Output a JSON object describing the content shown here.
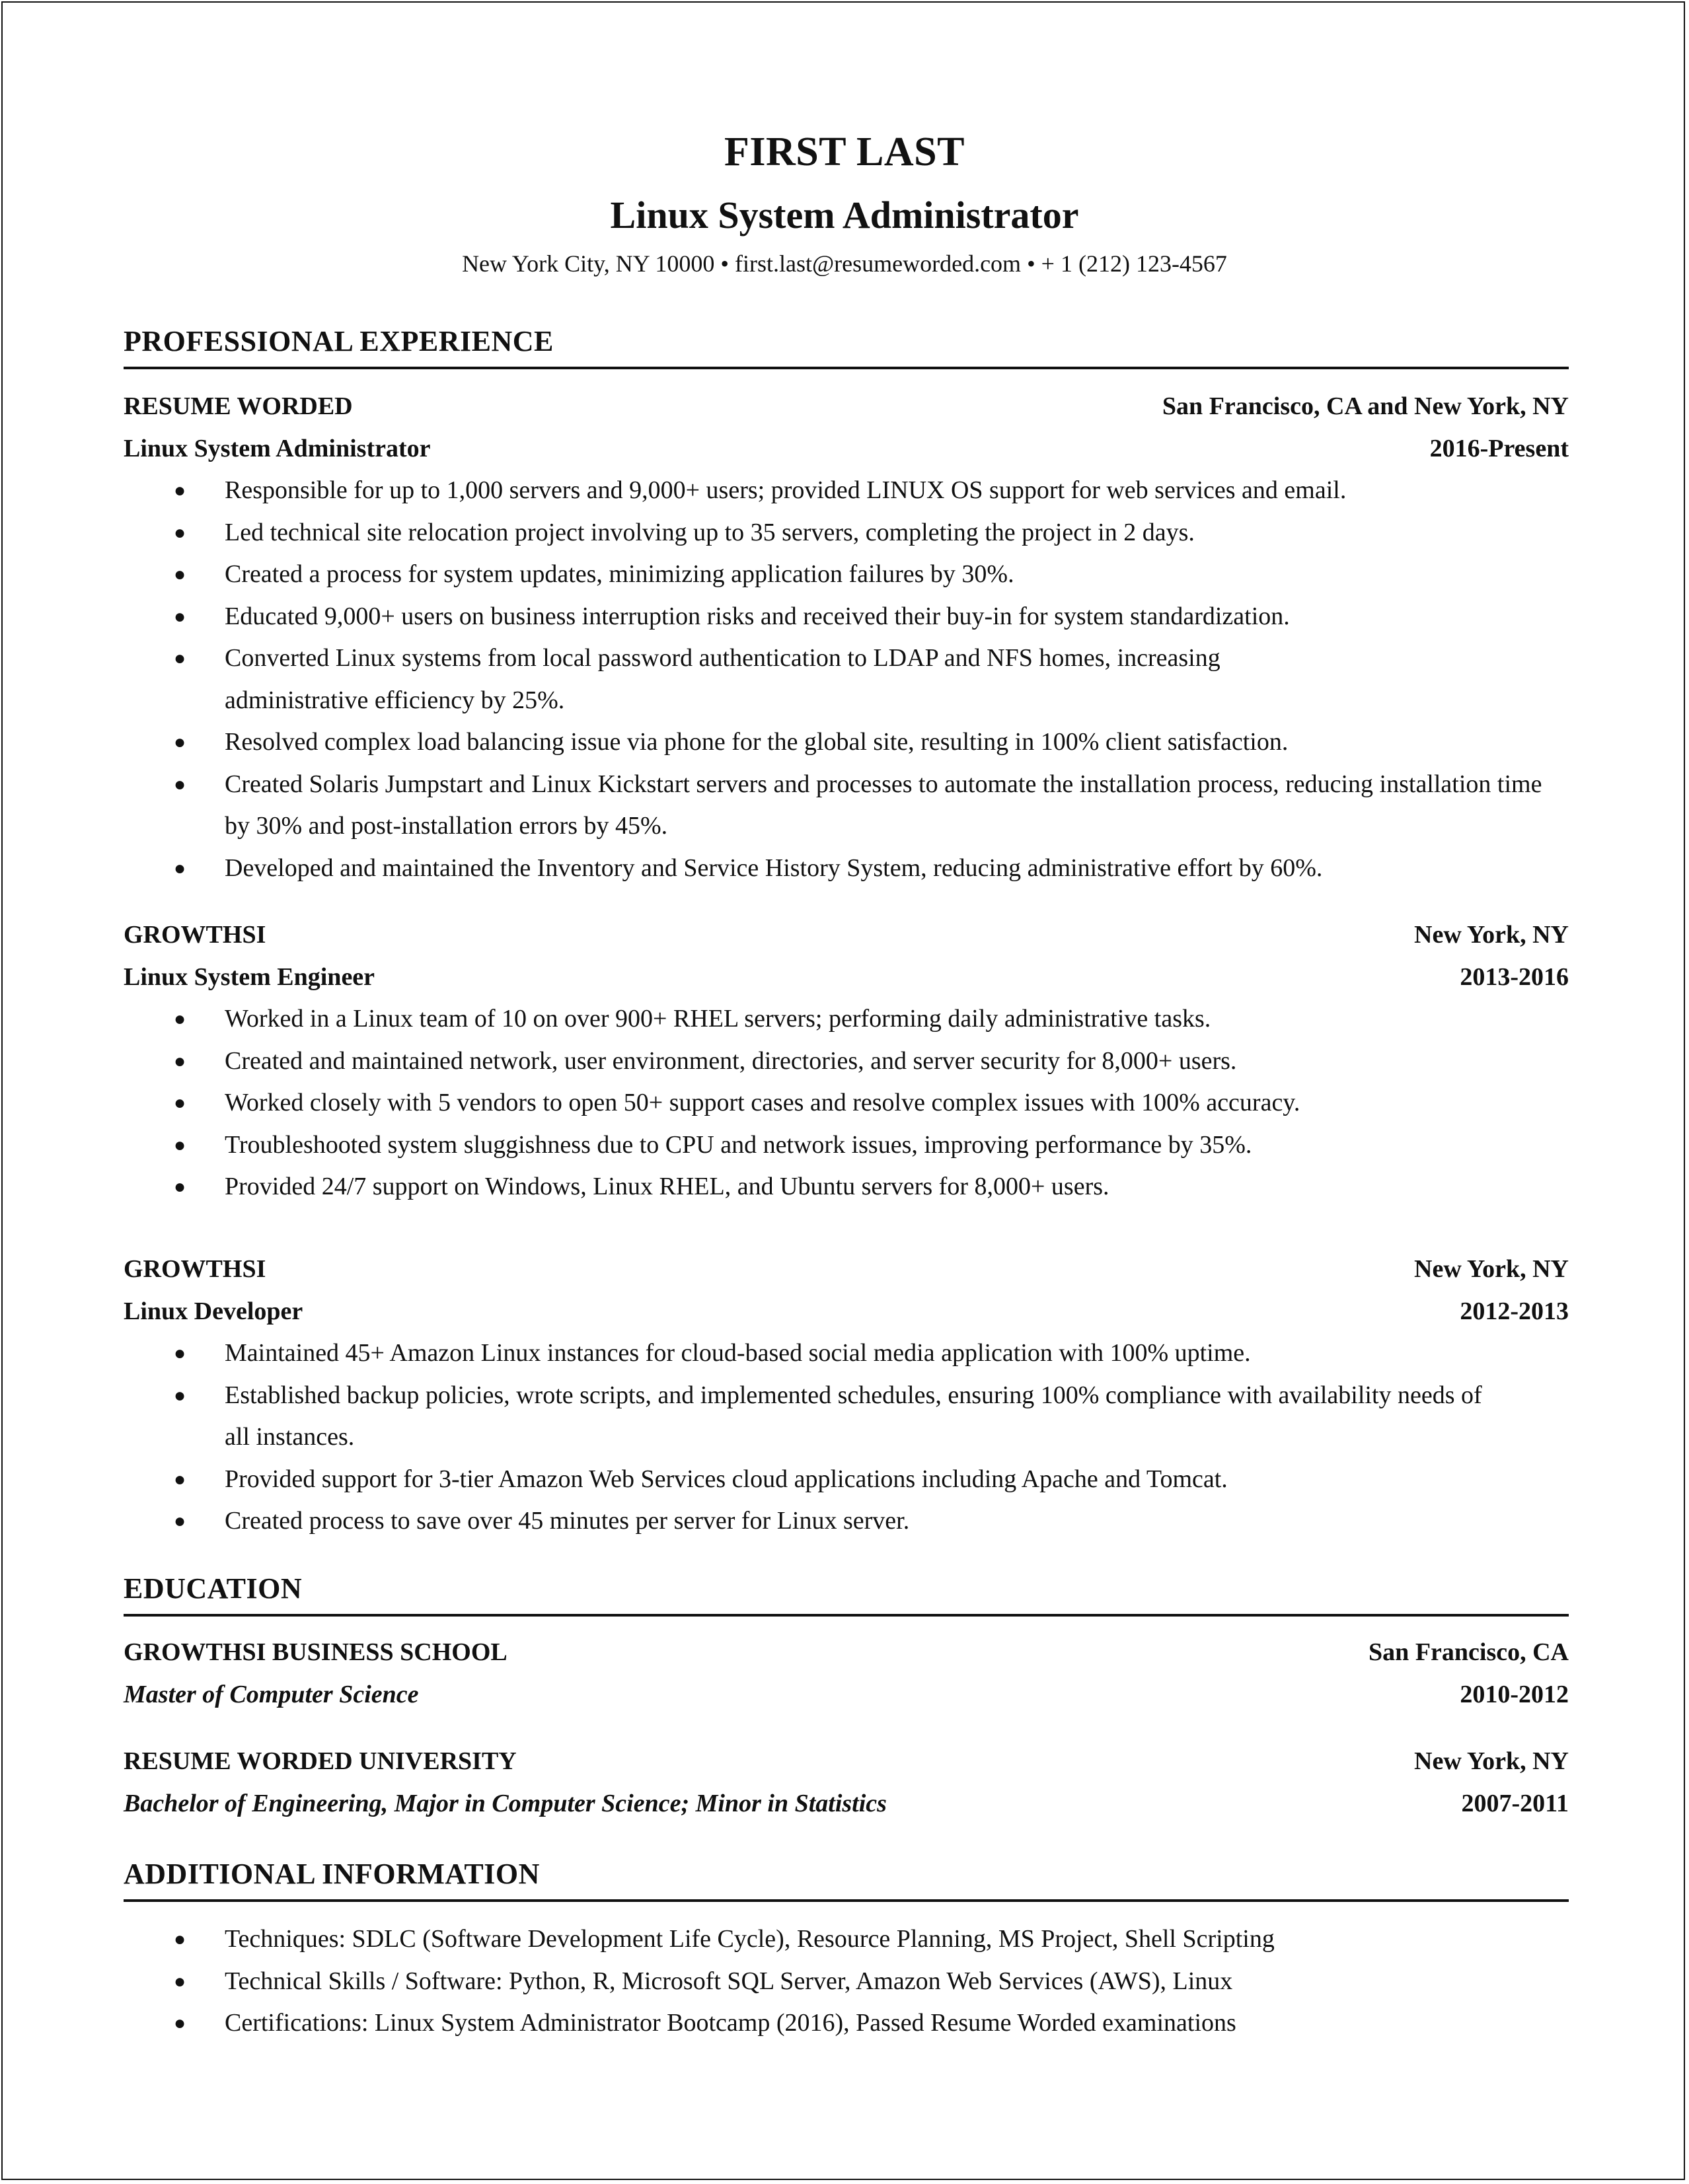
{
  "header": {
    "name": "FIRST LAST",
    "title": "Linux System Administrator",
    "contact": "New York City, NY 10000 • first.last@resumeworded.com • + 1 (212) 123-4567"
  },
  "sections": {
    "experience": {
      "heading": "PROFESSIONAL EXPERIENCE",
      "jobs": [
        {
          "company": "RESUME WORDED",
          "location": "San Francisco, CA and New York, NY",
          "role": "Linux System Administrator",
          "dates": "2016-Present",
          "bullets": [
            "Responsible for up to 1,000 servers and 9,000+ users; provided LINUX OS support for web services and email.",
            "Led technical site relocation project involving up to 35 servers, completing the project in 2 days.",
            "Created a process for system updates, minimizing application failures by 30%.",
            "Educated 9,000+ users on business interruption risks and received their buy-in for system standardization.",
            "Converted Linux systems from local password authentication to LDAP and NFS homes, increasing administrative efficiency by 25%.",
            "Resolved complex load balancing issue via phone for the global site, resulting in 100% client satisfaction.",
            "Created Solaris Jumpstart and Linux Kickstart servers and processes to automate the installation process, reducing installation time by 30% and post-installation errors by 45%.",
            "Developed and maintained the Inventory and Service History System, reducing administrative effort by 60%."
          ]
        },
        {
          "company": "GROWTHSI",
          "location": "New York, NY",
          "role": "Linux System Engineer",
          "dates": "2013-2016",
          "bullets": [
            "Worked in a Linux team of 10 on over 900+ RHEL servers; performing daily administrative tasks.",
            "Created and maintained network, user environment, directories, and server security for 8,000+ users.",
            "Worked closely with 5 vendors to open 50+ support cases and resolve complex issues with 100% accuracy.",
            "Troubleshooted system sluggishness due to CPU and network issues, improving performance by 35%.",
            "Provided 24/7 support on Windows, Linux RHEL, and Ubuntu servers for 8,000+ users."
          ]
        },
        {
          "company": "GROWTHSI",
          "location": "New York, NY",
          "role": "Linux Developer",
          "dates": "2012-2013",
          "bullets": [
            "Maintained 45+ Amazon Linux instances for cloud-based social media application with 100% uptime.",
            "Established backup policies, wrote scripts, and implemented schedules, ensuring 100% compliance with availability needs of all instances.",
            "Provided support for 3-tier Amazon Web Services cloud applications including Apache and Tomcat.",
            "Created process to save over 45 minutes per server for Linux server."
          ]
        }
      ]
    },
    "education": {
      "heading": "EDUCATION",
      "schools": [
        {
          "school": "GROWTHSI BUSINESS SCHOOL",
          "location": "San Francisco, CA",
          "degree": "Master of Computer Science",
          "dates": "2010-2012"
        },
        {
          "school": "RESUME WORDED UNIVERSITY",
          "location": "New York, NY",
          "degree": "Bachelor of Engineering, Major in Computer Science; Minor in Statistics",
          "dates": "2007-2011"
        }
      ]
    },
    "additional": {
      "heading": "ADDITIONAL INFORMATION",
      "bullets": [
        "Techniques: SDLC (Software Development Life Cycle), Resource Planning, MS Project, Shell Scripting",
        "Technical Skills / Software: Python, R, Microsoft SQL Server, Amazon Web Services (AWS), Linux",
        "Certifications: Linux System Administrator Bootcamp (2016), Passed Resume Worded examinations"
      ]
    }
  },
  "bullet_glyph": "●"
}
